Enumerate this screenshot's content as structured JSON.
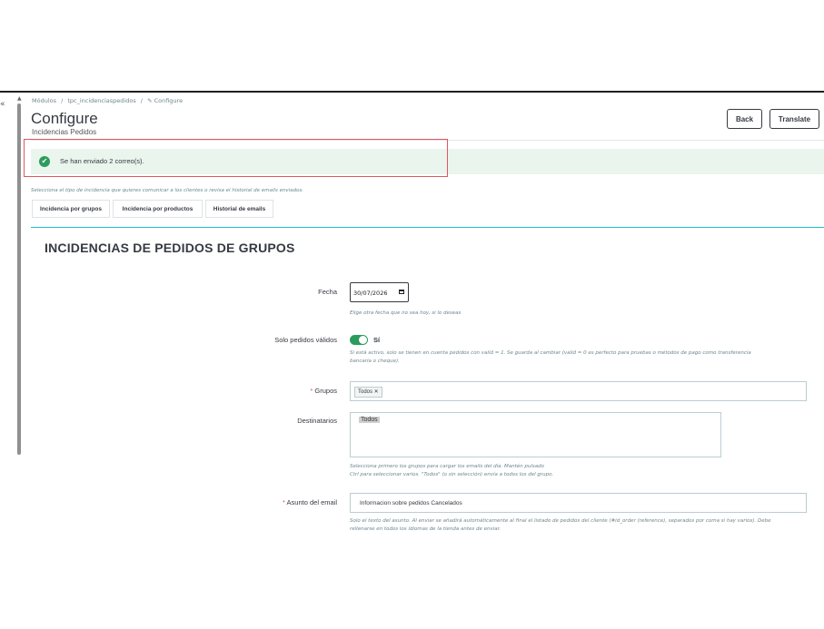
{
  "sidebar": {
    "collapse_glyph": "«"
  },
  "breadcrumb": [
    "Módulos",
    "/",
    "tpc_incidenciaspedidos",
    "/",
    "✎ Configure"
  ],
  "header": {
    "title": "Configure",
    "subtitle": "Incidencias Pedidos",
    "back_label": "Back",
    "translate_label": "Translate"
  },
  "alert": {
    "icon": "check-icon",
    "text": "Se han enviado 2 correo(s)."
  },
  "intro": "Selecciona el tipo de incidencia que quieres comunicar a los clientes o revisa el historial de emails enviados.",
  "tabs": [
    {
      "label": "Incidencia por grupos"
    },
    {
      "label": "Incidencia por productos"
    },
    {
      "label": "Historial de emails"
    }
  ],
  "panel": {
    "title": "INCIDENCIAS DE PEDIDOS DE GRUPOS",
    "fecha": {
      "label": "Fecha",
      "value": "30/07/2026",
      "help": "Elige otra fecha que no sea hoy, si lo deseas"
    },
    "solo_validos": {
      "label": "Solo pedidos válidos",
      "state": "Sí",
      "help_1": "Si está activo, solo se tienen en cuenta pedidos con valid = 1. Se guarda al cambiar (valid = 0 es perfecto para pruebas o métodos de pago como transferencia",
      "help_2": "bancaria o cheque)."
    },
    "grupos": {
      "required_mark": "*",
      "label": "Grupos",
      "tag": "Todos ✕"
    },
    "destinatarios": {
      "label": "Destinatarios",
      "option": "Todos",
      "help_1": "Selecciona primero los grupos para cargar los emails del día. Mantén pulsado",
      "help_2": "Ctrl para seleccionar varios. \"Todos\" (o sin selección) envía a todos los del grupo."
    },
    "asunto": {
      "required_mark": "*",
      "label": "Asunto del email",
      "value": "Informacion sobre pedidos Cancelados",
      "help_1": "Solo el texto del asunto. Al enviar se añadirá automáticamente al final el listado de pedidos del cliente (#id_order (reference), separados por coma si hay varios). Debe",
      "help_2": "rellenarse en todos los idiomas de la tienda antes de enviar."
    }
  }
}
